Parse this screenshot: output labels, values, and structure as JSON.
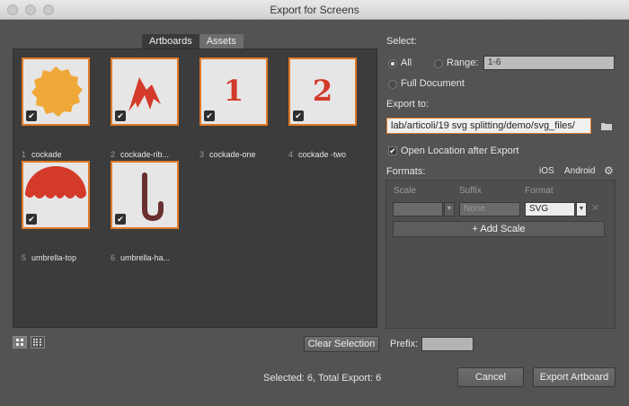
{
  "window": {
    "title": "Export for Screens"
  },
  "tabs": [
    {
      "label": "Artboards",
      "active": true
    },
    {
      "label": "Assets",
      "active": false
    }
  ],
  "artboards": [
    {
      "num": "1",
      "name": "cockade",
      "glyph": ""
    },
    {
      "num": "2",
      "name": "cockade-rib...",
      "glyph": ""
    },
    {
      "num": "3",
      "name": "cockade-one",
      "glyph": "1"
    },
    {
      "num": "4",
      "name": "cockade -two",
      "glyph": "2"
    },
    {
      "num": "5",
      "name": "umbrella-top",
      "glyph": ""
    },
    {
      "num": "6",
      "name": "umbrella-ha...",
      "glyph": ""
    }
  ],
  "select": {
    "label": "Select:",
    "all": "All",
    "range": "Range:",
    "range_value": "1-6",
    "full_document": "Full Document"
  },
  "export_to": {
    "label": "Export to:",
    "path": "lab/articoli/19 svg splitting/demo/svg_files/",
    "open_location": "Open Location after Export"
  },
  "formats": {
    "label": "Formats:",
    "ios": "iOS",
    "android": "Android",
    "col_scale": "Scale",
    "col_suffix": "Suffix",
    "col_format": "Format",
    "suffix_placeholder": "None",
    "format_value": "SVG",
    "add_scale": "+ Add Scale"
  },
  "bottom": {
    "clear_selection": "Clear Selection",
    "prefix": "Prefix:",
    "status": "Selected: 6, Total Export: 6",
    "cancel": "Cancel",
    "export": "Export Artboard"
  },
  "colors": {
    "accent": "#e07a28",
    "cockade": "#f0a838",
    "red": "#d43a2a",
    "handle": "#6a3030"
  }
}
